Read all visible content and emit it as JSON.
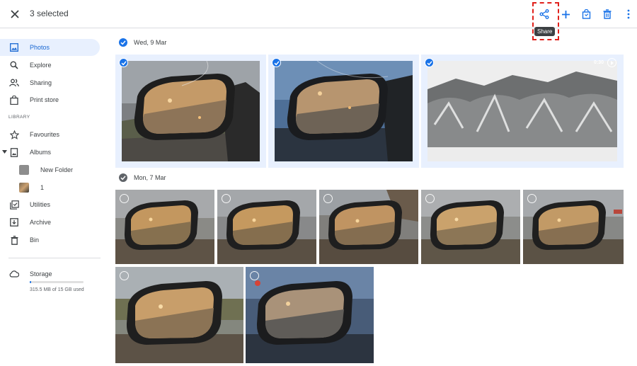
{
  "header": {
    "selected_count": "3 selected",
    "tooltip": "Share"
  },
  "sidebar": {
    "items": [
      {
        "label": "Photos",
        "icon": "image-icon"
      },
      {
        "label": "Explore",
        "icon": "search-icon"
      },
      {
        "label": "Sharing",
        "icon": "people-icon"
      },
      {
        "label": "Print store",
        "icon": "shopping-bag-icon"
      }
    ],
    "library_label": "LIBRARY",
    "library_items": [
      {
        "label": "Favourites",
        "icon": "star-icon"
      },
      {
        "label": "Albums",
        "icon": "album-icon"
      }
    ],
    "albums": [
      {
        "label": "New Folder"
      },
      {
        "label": "1"
      }
    ],
    "other_items": [
      {
        "label": "Utilities",
        "icon": "utilities-icon"
      },
      {
        "label": "Archive",
        "icon": "archive-icon"
      },
      {
        "label": "Bin",
        "icon": "bin-icon"
      }
    ],
    "storage": {
      "label": "Storage",
      "usage": "315.5 MB of 15 GB used",
      "fraction_used": 0.021
    }
  },
  "groups": [
    {
      "date": "Wed, 9 Mar"
    },
    {
      "date": "Mon, 7 Mar"
    }
  ],
  "video": {
    "duration": "0:30"
  },
  "colors": {
    "accent": "#1a73e8",
    "highlight": "#e0201b",
    "selected_tile": "#e8f0fe"
  }
}
